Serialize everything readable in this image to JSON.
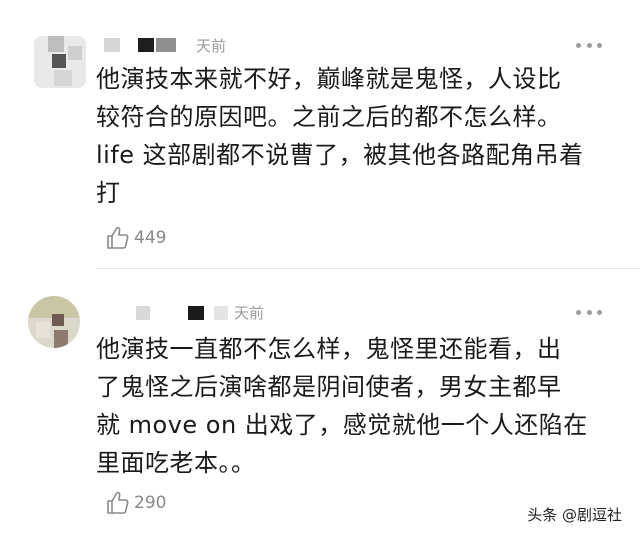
{
  "comments": [
    {
      "time_fragment": "天前",
      "text_lines": [
        "他演技本来就不好，巅峰就是鬼怪，人设比",
        "较符合的原因吧。之前之后的都不怎么样。",
        "life 这部剧都不说曹了，被其他各路配角吊着",
        "打"
      ],
      "likes": "449"
    },
    {
      "time_fragment": "天前",
      "text_lines": [
        "他演技一直都不怎么样，鬼怪里还能看，出",
        "了鬼怪之后演啥都是阴间使者，男女主都早",
        "就 move on 出戏了，感觉就他一个人还陷在",
        "里面吃老本。。"
      ],
      "likes": "290"
    }
  ],
  "watermark": "头条 @剧逗社"
}
